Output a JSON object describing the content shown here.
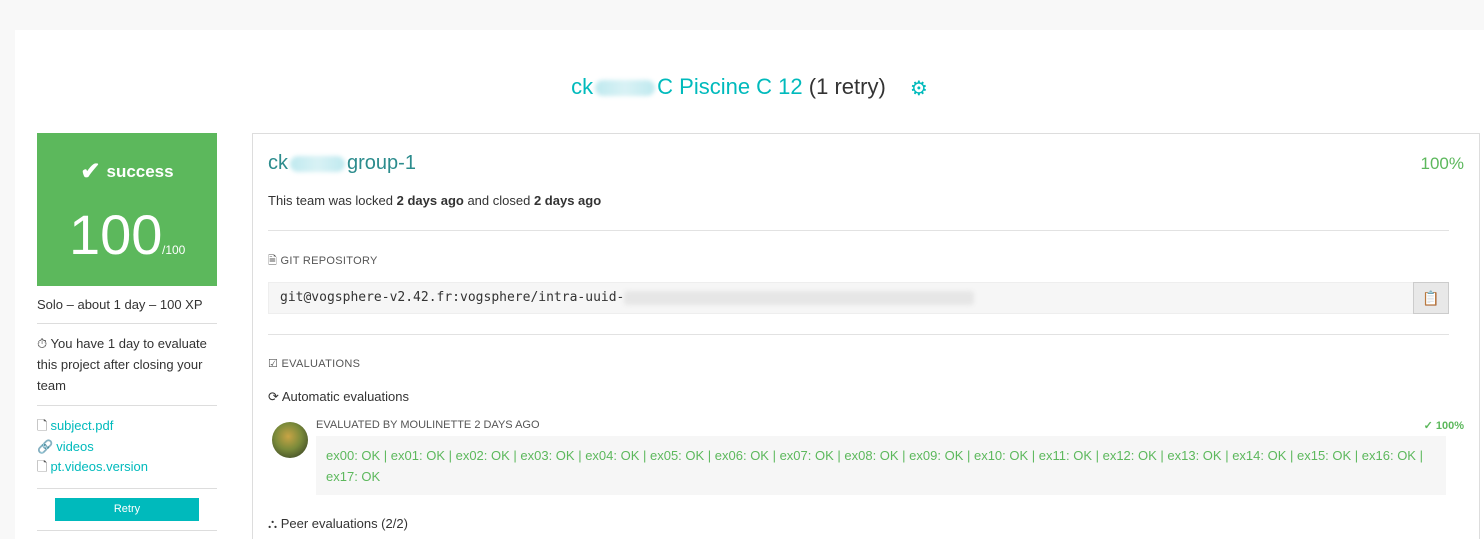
{
  "header": {
    "title_prefix": "ck",
    "title_project": "C Piscine C 12",
    "title_retry": "(1 retry)",
    "settings_icon": "gear-icon"
  },
  "score": {
    "status": "success",
    "mark": "100",
    "max": "/100",
    "color": "#5cb85c"
  },
  "sidebar": {
    "meta": "Solo – about 1 day – 100 XP",
    "note": "You have 1 day to evaluate this project after closing your team",
    "links": [
      {
        "label": "subject.pdf",
        "icon": "document-icon"
      },
      {
        "label": "videos",
        "icon": "paperclip-icon"
      },
      {
        "label": "pt.videos.version",
        "icon": "document-icon"
      }
    ],
    "retry_label": "Retry"
  },
  "team": {
    "name_prefix": "ck",
    "name_suffix": "group-1",
    "percent": "100%",
    "lock_pre": "This team was locked",
    "locked_when": "2 days ago",
    "lock_mid": "and closed",
    "closed_when": "2 days ago"
  },
  "git": {
    "heading": "GIT REPOSITORY",
    "url": "git@vogsphere-v2.42.fr:vogsphere/intra-uuid-"
  },
  "evaluations": {
    "heading": "EVALUATIONS",
    "automatic_heading": "Automatic evaluations",
    "evaluated_by": "EVALUATED BY MOULINETTE 2 DAYS AGO",
    "score": "100%",
    "result_text": "ex00: OK | ex01: OK | ex02: OK | ex03: OK | ex04: OK | ex05: OK | ex06: OK | ex07: OK | ex08: OK | ex09: OK | ex10: OK | ex11: OK | ex12: OK | ex13: OK | ex14: OK | ex15: OK | ex16: OK | ex17: OK",
    "peer_heading": "Peer evaluations (2/2)"
  },
  "colors": {
    "accent": "#00babc",
    "success": "#5cb85c"
  }
}
